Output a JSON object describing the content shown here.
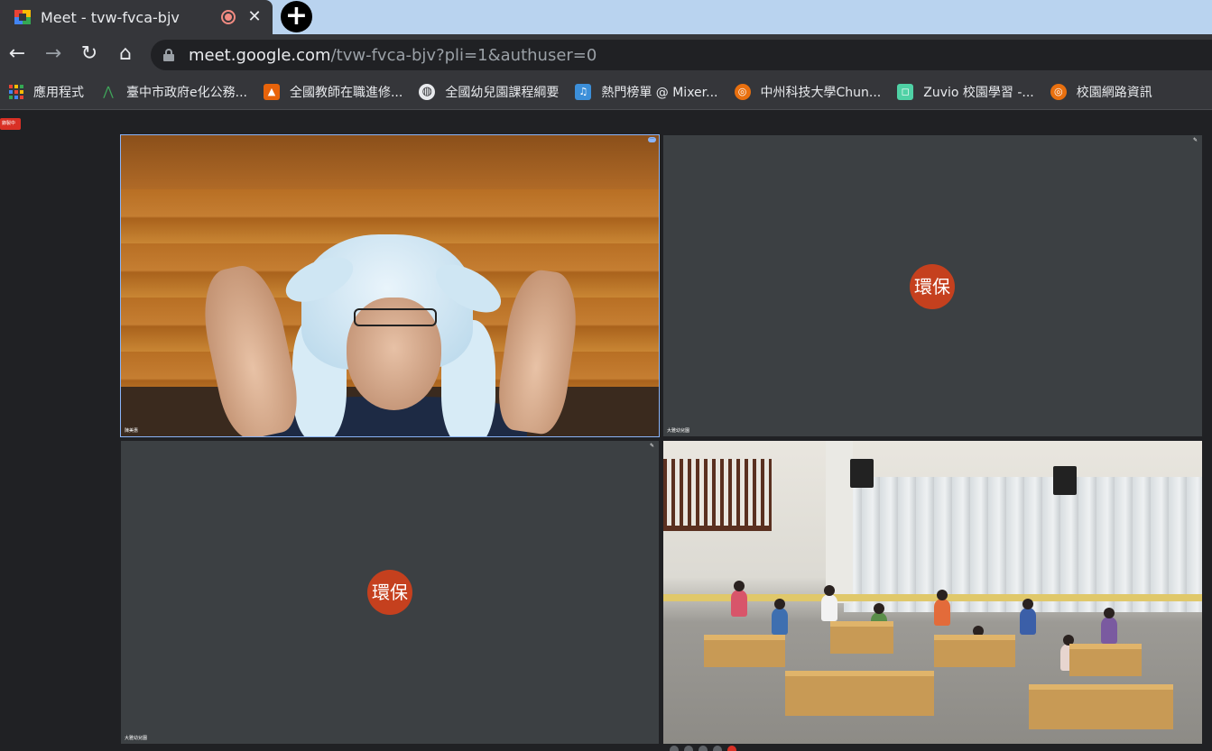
{
  "tab": {
    "title": "Meet - tvw-fvca-bjv",
    "close_glyph": "✕",
    "newtab_glyph": "+"
  },
  "toolbar": {
    "back_glyph": "←",
    "forward_glyph": "→",
    "reload_glyph": "↻",
    "home_glyph": "⌂",
    "url_host": "meet.google.com",
    "url_path": "/tvw-fvca-bjv?pli=1&authuser=0"
  },
  "bookmarks": [
    {
      "label": "應用程式",
      "icon": "apps-grid-icon"
    },
    {
      "label": "臺中市政府e化公務...",
      "icon": "taichung-logo-icon",
      "color": "#2a6e3f"
    },
    {
      "label": "全國教師在職進修...",
      "icon": "teacher-training-icon",
      "color": "#e8630a"
    },
    {
      "label": "全國幼兒園課程綱要",
      "icon": "globe-icon",
      "color": "#e8eaed"
    },
    {
      "label": "熱門榜單 @ Mixer...",
      "icon": "music-icon",
      "color": "#3c8fd9"
    },
    {
      "label": "中州科技大學Chun...",
      "icon": "university-logo-icon",
      "color": "#e9700f"
    },
    {
      "label": "Zuvio 校園學習 -...",
      "icon": "zuvio-icon",
      "color": "#4fd1a5"
    },
    {
      "label": "校園網路資訊",
      "icon": "campus-network-icon",
      "color": "#e9700f"
    }
  ],
  "meet": {
    "recording_badge": "錄製中",
    "tiles": [
      {
        "name": "陳美惠",
        "type": "video-teacher"
      },
      {
        "name": "大雅幼兒園",
        "type": "avatar",
        "avatar_text": "環保"
      },
      {
        "name": "大雅幼兒園",
        "type": "avatar",
        "avatar_text": "環保"
      },
      {
        "name": "",
        "type": "video-classroom"
      }
    ]
  },
  "colors": {
    "tab_bar": "#b9d3ef",
    "chrome_dark": "#35363a",
    "meet_bg": "#202124",
    "tile_bg": "#3c4043",
    "avatar": "#c5401e",
    "recording": "#d93025"
  }
}
